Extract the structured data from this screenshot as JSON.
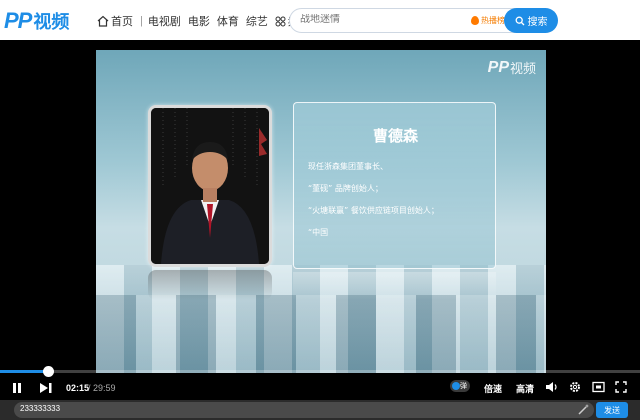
{
  "header": {
    "logo_mark": "PP",
    "logo_text": "视频",
    "nav": {
      "home": "首页",
      "items": [
        "电视剧",
        "电影",
        "体育",
        "综艺"
      ],
      "channels": "频道"
    },
    "search": {
      "placeholder": "战地迷情",
      "hot_label": "热播榜",
      "button_label": "搜索"
    }
  },
  "video": {
    "watermark_mark": "PP",
    "watermark_text": "视频",
    "person_name": "曹德森",
    "lines": [
      "现任浙森集团董事长、",
      "“董砚” 品牌创始人；",
      "“火塘联赢” 餐饮供应链项目创始人；",
      "“中国"
    ]
  },
  "controls": {
    "current_time": "02:15",
    "total_time": "/ 29:59",
    "progress": 0.075,
    "danmu_label": "弹",
    "speed_label": "倍速",
    "quality_label": "高清"
  },
  "danmu": {
    "value": "233333333",
    "send_label": "发送"
  },
  "colors": {
    "accent": "#1e8de6",
    "player_bg": "#000000"
  }
}
